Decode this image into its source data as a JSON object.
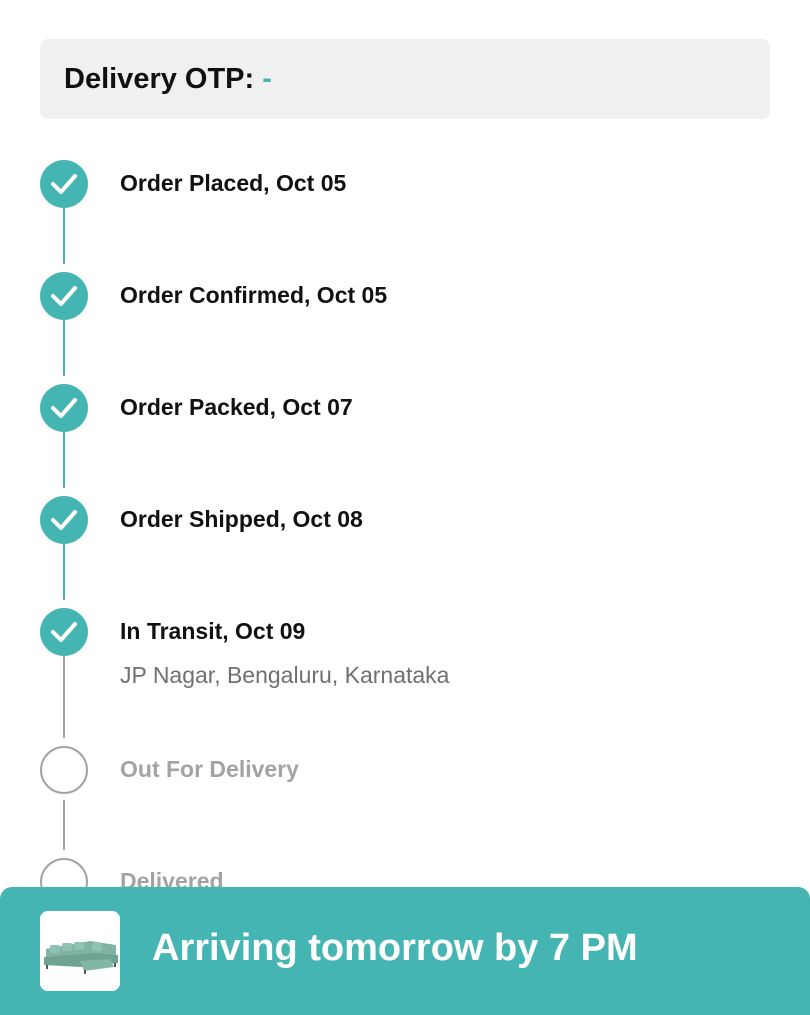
{
  "otp": {
    "label": "Delivery OTP:",
    "value": "-"
  },
  "timeline": {
    "steps": [
      {
        "label": "Order Placed, Oct 05",
        "status": "done"
      },
      {
        "label": "Order Confirmed, Oct 05",
        "status": "done"
      },
      {
        "label": "Order Packed, Oct 07",
        "status": "done"
      },
      {
        "label": "Order Shipped, Oct 08",
        "status": "done"
      },
      {
        "label": "In Transit, Oct 09",
        "location": "JP Nagar, Bengaluru, Karnataka",
        "status": "done"
      },
      {
        "label": "Out For Delivery",
        "status": "pending"
      },
      {
        "label": "Delivered",
        "status": "pending"
      }
    ],
    "icons": {
      "done": "check-circle-icon",
      "pending": "empty-circle-icon"
    }
  },
  "banner": {
    "text": "Arriving tomorrow by 7 PM",
    "thumbnail": "sofa-product-thumbnail"
  },
  "colors": {
    "accent": "#45b5b3",
    "pending": "#a3a3a3",
    "otp_background": "#f0f0f0"
  }
}
